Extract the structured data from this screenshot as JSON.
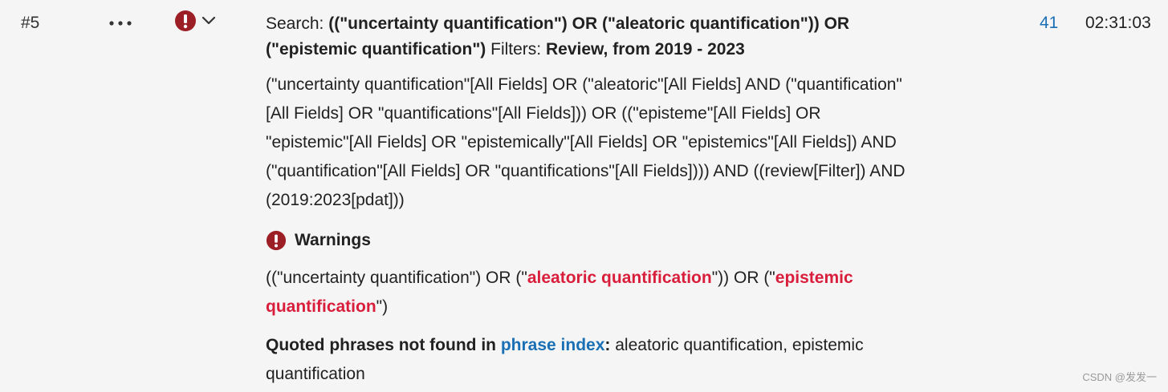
{
  "history_row": {
    "number": "#5",
    "more_actions_icon": "ellipsis-icon",
    "warning_icon": "exclamation-circle-icon",
    "expand_icon": "chevron-down-icon",
    "search_prefix": "Search:",
    "search_terms": "((\"uncertainty quantification\") OR (\"aleatoric quantification\")) OR (\"epistemic quantification\")",
    "filters_prefix": "Filters:",
    "filters_value": "Review, from 2019 - 2023",
    "query_details": "(\"uncertainty quantification\"[All Fields] OR (\"aleatoric\"[All Fields] AND (\"quantification\"[All Fields] OR \"quantifications\"[All Fields])) OR ((\"episteme\"[All Fields] OR \"epistemic\"[All Fields] OR \"epistemically\"[All Fields] OR \"epistemics\"[All Fields]) AND (\"quantification\"[All Fields] OR \"quantifications\"[All Fields]))) AND ((review[Filter]) AND (2019:2023[pdat]))",
    "results_count": "41",
    "time": "02:31:03"
  },
  "warnings": {
    "heading": "Warnings",
    "query_part1": "((\"uncertainty quantification\") OR (\"",
    "highlight1": "aleatoric quantification",
    "query_part2": "\")) OR (\"",
    "highlight2": "epistemic quantification",
    "query_part3": "\")",
    "notfound_label": "Quoted phrases not found in",
    "notfound_link": "phrase index",
    "notfound_colon": ":",
    "notfound_list": "aleatoric quantification, epistemic quantification"
  },
  "watermark": "CSDN @发发一",
  "colors": {
    "background": "#f5f5f5",
    "link": "#1a6fb5",
    "warning": "#9d1f26",
    "highlight": "#d91e3c"
  }
}
